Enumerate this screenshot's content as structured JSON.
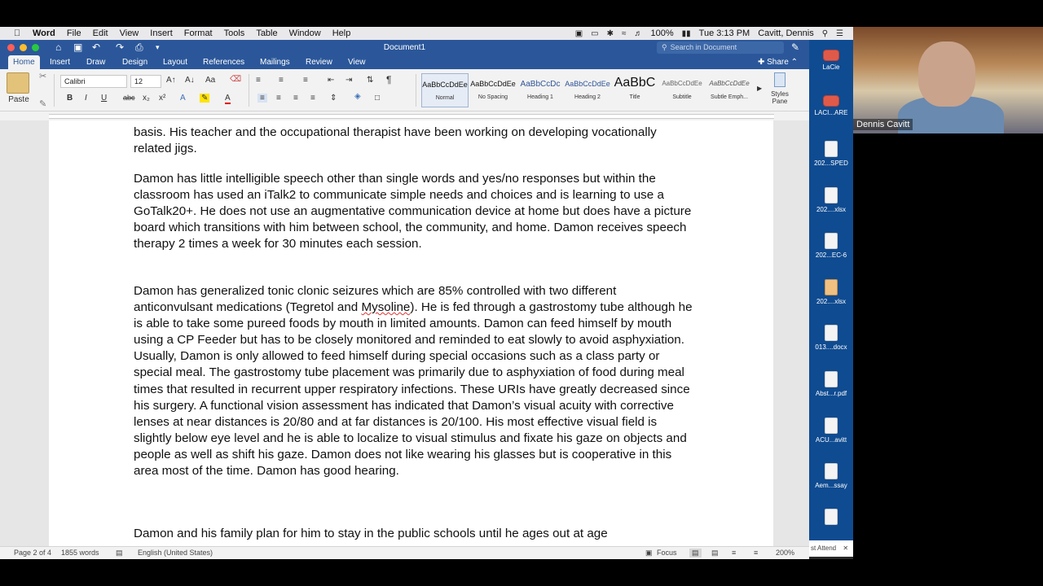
{
  "menubar": {
    "app_name": "Word",
    "items": [
      "File",
      "Edit",
      "View",
      "Insert",
      "Format",
      "Tools",
      "Table",
      "Window",
      "Help"
    ],
    "battery": "100%",
    "clock": "Tue 3:13 PM",
    "user": "Cavitt, Dennis"
  },
  "window": {
    "title": "Document1",
    "search_placeholder": "Search in Document",
    "share_label": "Share"
  },
  "tabs": [
    "Home",
    "Insert",
    "Draw",
    "Design",
    "Layout",
    "References",
    "Mailings",
    "Review",
    "View"
  ],
  "ribbon": {
    "paste_label": "Paste",
    "font_name": "Calibri",
    "font_size": "12",
    "styles": [
      {
        "sample": "AaBbCcDdEe",
        "name": "Normal"
      },
      {
        "sample": "AaBbCcDdEe",
        "name": "No Spacing"
      },
      {
        "sample": "AaBbCcDc",
        "name": "Heading 1"
      },
      {
        "sample": "AaBbCcDdEe",
        "name": "Heading 2"
      },
      {
        "sample": "AaBbC",
        "name": "Title"
      },
      {
        "sample": "AaBbCcDdEe",
        "name": "Subtitle"
      },
      {
        "sample": "AaBbCcDdEe",
        "name": "Subtle Emph..."
      }
    ],
    "styles_pane_label": "Styles Pane"
  },
  "document": {
    "paragraphs": [
      "basis. His teacher and the occupational therapist have been working on developing vocationally related jigs.",
      "Damon has little intelligible speech other than single words and yes/no responses but within the classroom has used an iTalk2 to communicate simple needs and choices and is learning to use a GoTalk20+. He does not use an augmentative communication device at home but does have a picture board which transitions with him between school, the community, and home. Damon receives speech therapy 2 times a week for 30 minutes each session.",
      "Damon has generalized tonic clonic seizures which are 85% controlled with two different anticonvulsant medications (Tegretol and ",
      "Mysoline",
      "). He is fed through a gastrostomy tube although he is able to take some pureed foods by mouth in limited amounts. Damon can feed himself by mouth using a CP Feeder but has to be closely monitored and reminded to eat slowly to avoid asphyxiation. Usually, Damon is only allowed to feed himself during special occasions such as a class party or special meal. The gastrostomy tube placement was primarily due to asphyxiation of food during meal times that resulted in recurrent upper respiratory infections. These URIs have greatly decreased since his surgery. A functional vision assessment has indicated that Damon’s visual acuity with corrective lenses at near distances is 20/80 and at far distances is 20/100. His most effective visual field is slightly below eye level and he is able to localize to visual stimulus and fixate his gaze on objects and people as well as shift his gaze. Damon does not like wearing his glasses but is cooperative in this area most of the time. Damon has good hearing.",
      "Damon and his family plan for him to stay in the public schools until he ages out at age"
    ]
  },
  "status": {
    "page": "Page 2 of 4",
    "words": "1855 words",
    "language": "English (United States)",
    "focus": "Focus",
    "zoom": "200%"
  },
  "desktop_icons": [
    {
      "label": "LaCie",
      "icon": "drive-icon"
    },
    {
      "label": "LACI...ARE",
      "icon": "drive-icon"
    },
    {
      "label": "202...SPED",
      "icon": "file-icon"
    },
    {
      "label": "202....xlsx",
      "icon": "file-icon"
    },
    {
      "label": "202...EC-6",
      "icon": "file-icon"
    },
    {
      "label": "202....xlsx",
      "icon": "file-icon"
    },
    {
      "label": "013....docx",
      "icon": "file-icon"
    },
    {
      "label": "Abst...r.pdf",
      "icon": "file-icon"
    },
    {
      "label": "ACU...avitt",
      "icon": "file-icon"
    },
    {
      "label": "Aem...ssay",
      "icon": "file-icon"
    }
  ],
  "video": {
    "participant_name": "Dennis Cavitt"
  },
  "attendee_label": "st Attend"
}
